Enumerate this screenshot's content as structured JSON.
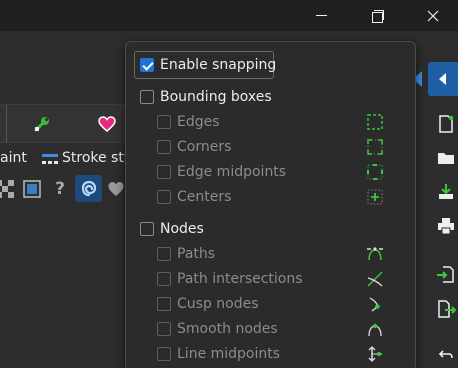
{
  "window": {
    "minimize_icon": "minimize-icon",
    "maximize_icon": "restore-icon",
    "close_icon": "close-icon"
  },
  "left_panel": {
    "tabs": [
      {
        "icon": "wrench-icon",
        "color": "#3cba3c"
      },
      {
        "icon": "heart-icon",
        "color": "#e8287c"
      }
    ],
    "subtabs": [
      "aint",
      "Stroke sty"
    ],
    "stroke_icon": "stroke-style-icon",
    "tools": [
      "pattern-icon",
      "square-icon",
      "question-icon",
      "swirl-icon",
      "heart-shape-icon"
    ]
  },
  "popover": {
    "enable_snapping": {
      "label": "Enable snapping",
      "checked": true
    },
    "bounding_boxes": {
      "label": "Bounding boxes",
      "checked": false,
      "items": [
        {
          "label": "Edges",
          "icon": "bbox-edges-icon"
        },
        {
          "label": "Corners",
          "icon": "bbox-corners-icon"
        },
        {
          "label": "Edge midpoints",
          "icon": "bbox-edge-midpoints-icon"
        },
        {
          "label": "Centers",
          "icon": "bbox-centers-icon"
        }
      ]
    },
    "nodes": {
      "label": "Nodes",
      "checked": false,
      "items": [
        {
          "label": "Paths",
          "icon": "paths-snap-icon"
        },
        {
          "label": "Path intersections",
          "icon": "path-intersections-icon"
        },
        {
          "label": "Cusp nodes",
          "icon": "cusp-nodes-icon"
        },
        {
          "label": "Smooth nodes",
          "icon": "smooth-nodes-icon"
        },
        {
          "label": "Line midpoints",
          "icon": "line-midpoints-icon"
        }
      ]
    }
  },
  "right_panel": {
    "toggle_icon": "chevron-left-icon",
    "icons": [
      "new-document-icon",
      "open-folder-icon",
      "save-icon",
      "print-icon",
      "import-icon",
      "export-icon",
      "undo-icon"
    ]
  },
  "colors": {
    "accent": "#1f74d4",
    "snap_green": "#3cc63c"
  }
}
